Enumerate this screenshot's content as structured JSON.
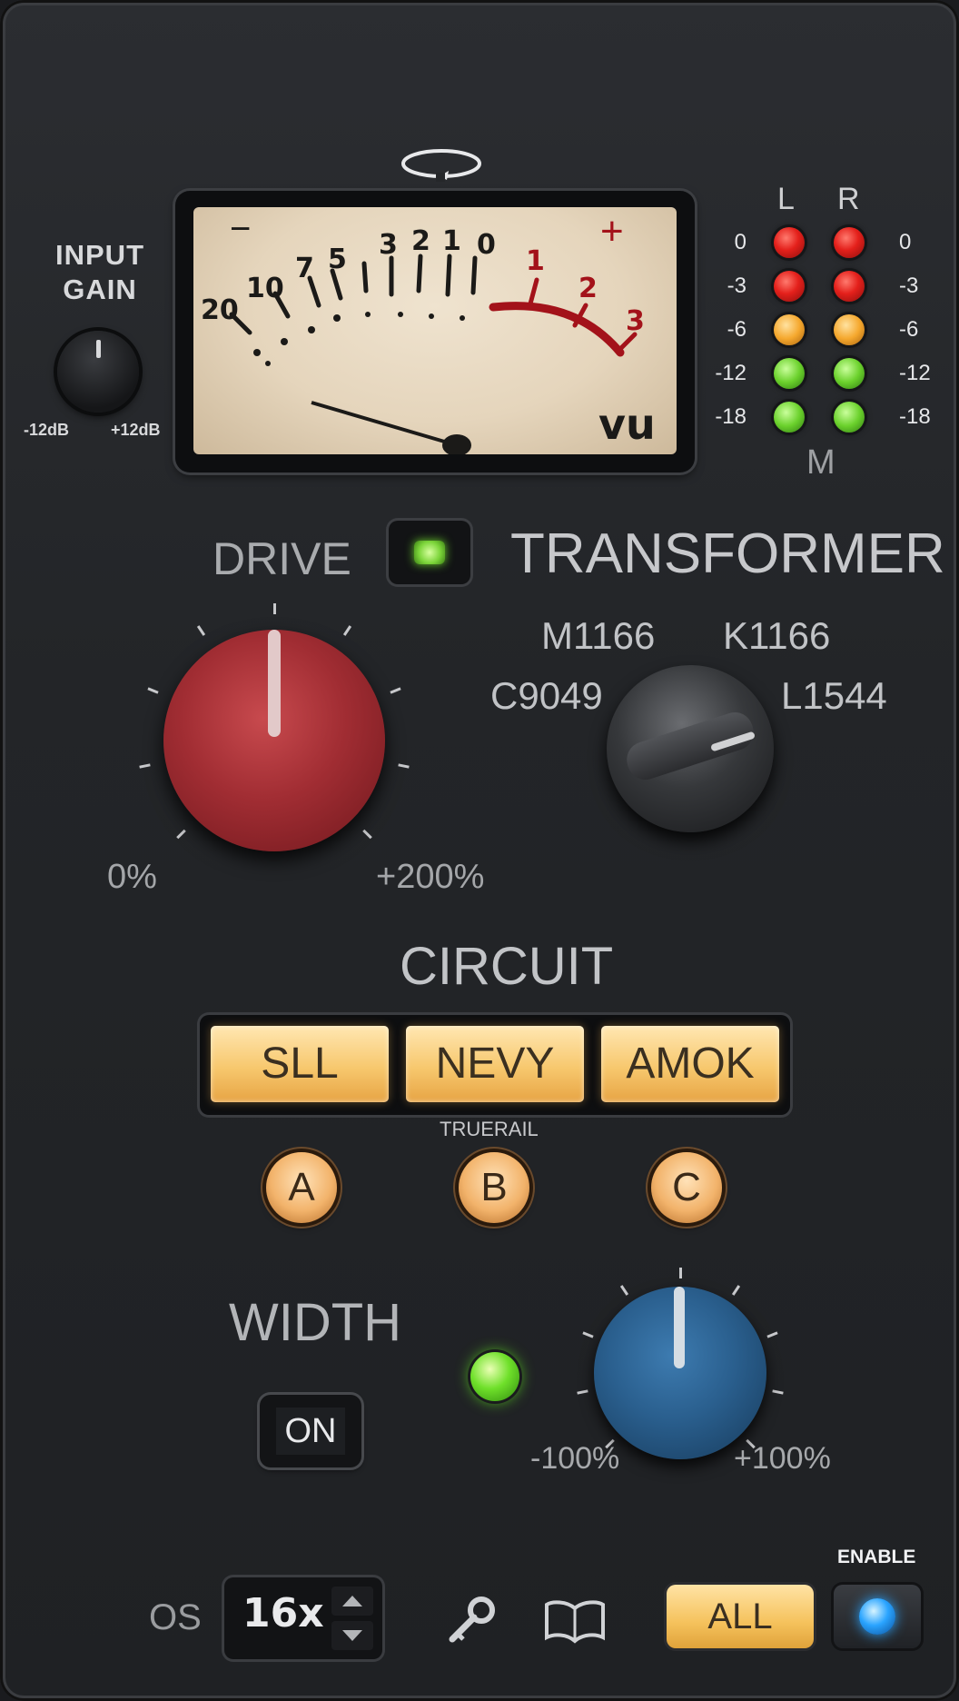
{
  "vu": {
    "scale": [
      "20",
      "10",
      "7",
      "5",
      "3",
      "2",
      "1",
      "0",
      "1",
      "2",
      "3"
    ],
    "minus": "−",
    "plus": "+",
    "unit": "vu",
    "loop_icon": "loop-arrow-icon"
  },
  "input_gain": {
    "title_line1": "INPUT",
    "title_line2": "GAIN",
    "min": "-12dB",
    "max": "+12dB"
  },
  "meter": {
    "left_label": "L",
    "right_label": "R",
    "mode_label": "M",
    "levels": [
      "0",
      "-3",
      "-6",
      "-12",
      "-18"
    ],
    "led_colors": [
      "red",
      "red",
      "orange",
      "green",
      "green"
    ]
  },
  "drive": {
    "label": "DRIVE",
    "min": "0%",
    "max": "+200%",
    "value_fraction": 0.5,
    "color": "#b0333a"
  },
  "transformer": {
    "label": "TRANSFORMER",
    "options": [
      "M1166",
      "K1166",
      "C9049",
      "L1544"
    ],
    "selected": "L1544",
    "led_on": true
  },
  "circuit": {
    "label": "CIRCUIT",
    "buttons": [
      "SLL",
      "NEVY",
      "AMOK"
    ],
    "truerail": "TRUERAIL",
    "variants": [
      "A",
      "B",
      "C"
    ]
  },
  "width": {
    "label": "WIDTH",
    "on_label": "ON",
    "min": "-100%",
    "max": "+100%",
    "value_fraction": 0.5,
    "led_on": true,
    "color": "#2f6b9e"
  },
  "footer": {
    "os_label": "OS",
    "os_value": "16x",
    "key_icon": "key-icon",
    "manual_icon": "book-icon",
    "all_label": "ALL",
    "enable_label": "ENABLE"
  }
}
